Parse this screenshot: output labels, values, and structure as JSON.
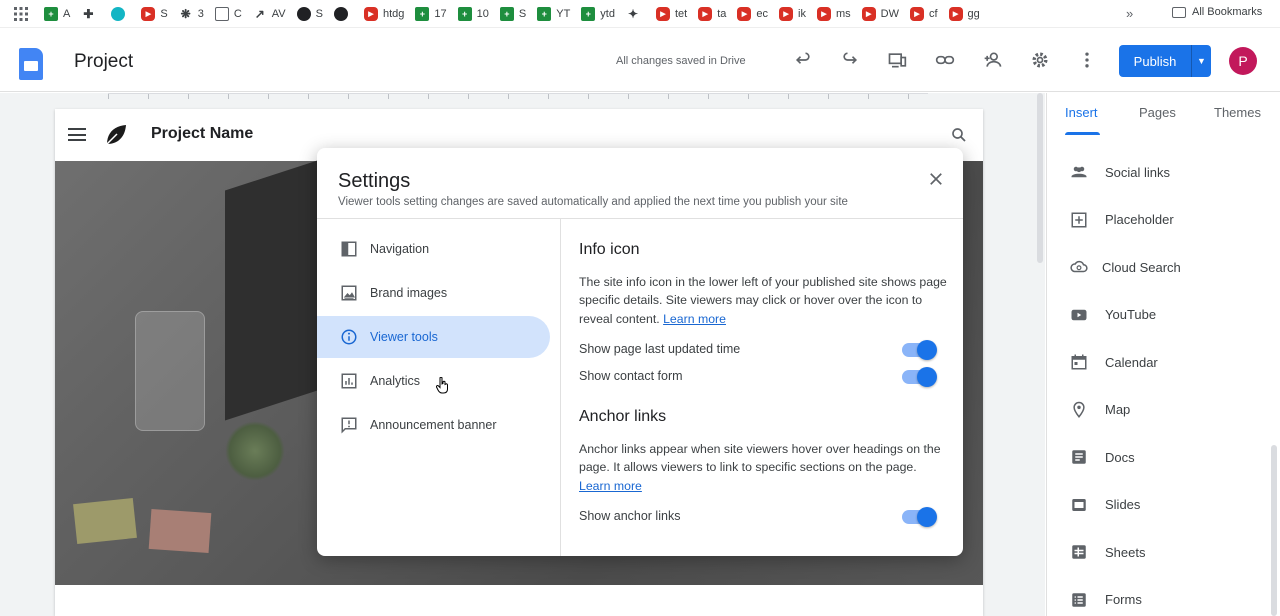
{
  "bookmarks": {
    "items": [
      {
        "label": "A",
        "icon": "sheets-icon"
      },
      {
        "label": "",
        "icon": "puzzle-icon"
      },
      {
        "label": "",
        "icon": "canva-icon"
      },
      {
        "label": "S",
        "icon": "youtube-icon"
      },
      {
        "label": "3",
        "icon": "openai-icon"
      },
      {
        "label": "C",
        "icon": "folder-icon"
      },
      {
        "label": "AV",
        "icon": "trend-icon"
      },
      {
        "label": "S",
        "icon": "globe-icon"
      },
      {
        "label": "",
        "icon": "github-icon"
      },
      {
        "label": "htdg",
        "icon": "youtube-icon"
      },
      {
        "label": "17",
        "icon": "sheets-icon"
      },
      {
        "label": "10",
        "icon": "sheets-icon"
      },
      {
        "label": "S",
        "icon": "sheets-icon"
      },
      {
        "label": "YT",
        "icon": "sheets-icon"
      },
      {
        "label": "ytd",
        "icon": "sheets-icon"
      },
      {
        "label": "",
        "icon": "pin-icon"
      },
      {
        "label": "tet",
        "icon": "youtube-icon"
      },
      {
        "label": "ta",
        "icon": "youtube-icon"
      },
      {
        "label": "ec",
        "icon": "youtube-icon"
      },
      {
        "label": "ik",
        "icon": "youtube-icon"
      },
      {
        "label": "ms",
        "icon": "youtube-icon"
      },
      {
        "label": "DW",
        "icon": "youtube-icon"
      },
      {
        "label": "cf",
        "icon": "youtube-icon"
      },
      {
        "label": "gg",
        "icon": "youtube-icon"
      }
    ],
    "more": "»",
    "all_bookmarks": "All Bookmarks"
  },
  "header": {
    "title": "Project",
    "save_status": "All changes saved in Drive",
    "publish_label": "Publish",
    "avatar_letter": "P"
  },
  "site": {
    "name": "Project Name"
  },
  "right_panel": {
    "tabs": [
      "Insert",
      "Pages",
      "Themes"
    ],
    "active_tab": "Insert",
    "items": [
      {
        "label": "Social links",
        "icon": "people-icon"
      },
      {
        "label": "Placeholder",
        "icon": "plus-box-icon"
      },
      {
        "label": "Cloud Search",
        "icon": "cloud-search-icon"
      },
      {
        "label": "YouTube",
        "icon": "youtube-icon"
      },
      {
        "label": "Calendar",
        "icon": "calendar-icon"
      },
      {
        "label": "Map",
        "icon": "map-pin-icon"
      },
      {
        "label": "Docs",
        "icon": "docs-icon"
      },
      {
        "label": "Slides",
        "icon": "slides-icon"
      },
      {
        "label": "Sheets",
        "icon": "sheets-icon"
      },
      {
        "label": "Forms",
        "icon": "forms-icon"
      }
    ]
  },
  "settings": {
    "title": "Settings",
    "subtitle": "Viewer tools setting changes are saved automatically and applied the next time you publish your site",
    "nav": [
      {
        "label": "Navigation",
        "icon": "navigation-icon"
      },
      {
        "label": "Brand images",
        "icon": "image-icon"
      },
      {
        "label": "Viewer tools",
        "icon": "info-icon"
      },
      {
        "label": "Analytics",
        "icon": "analytics-icon"
      },
      {
        "label": "Announcement banner",
        "icon": "announcement-icon"
      }
    ],
    "active_nav": "Viewer tools",
    "info_icon": {
      "title": "Info icon",
      "text": "The site info icon in the lower left of your published site shows page specific details. Site viewers may click or hover over the icon to reveal content.",
      "link": "Learn more",
      "toggles": [
        {
          "label": "Show page last updated time",
          "on": true
        },
        {
          "label": "Show contact form",
          "on": true
        }
      ]
    },
    "anchor_links": {
      "title": "Anchor links",
      "text": "Anchor links appear when site viewers hover over headings on the page. It allows viewers to link to specific sections on the page.",
      "link": "Learn more",
      "toggles": [
        {
          "label": "Show anchor links",
          "on": true
        }
      ]
    }
  },
  "colors": {
    "accent": "#1a73e8",
    "active_nav_bg": "#d2e3fc",
    "avatar": "#c2185b"
  }
}
